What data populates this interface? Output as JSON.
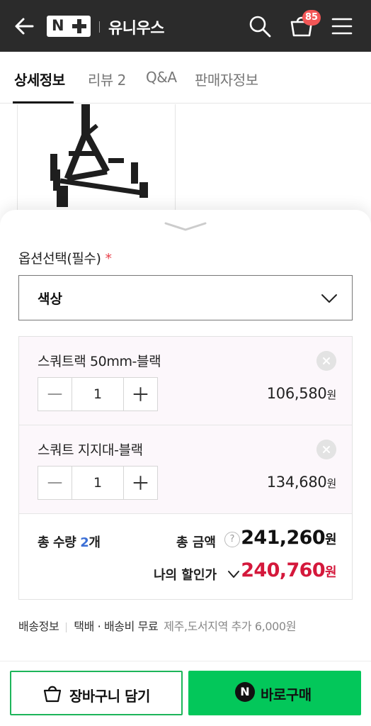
{
  "header": {
    "logo_text": "N",
    "store_name": "유니우스",
    "cart_count": "85"
  },
  "tabs": [
    {
      "label": "상세정보",
      "active": true
    },
    {
      "label": "리뷰 2"
    },
    {
      "label": "Q&A"
    },
    {
      "label": "판매자정보"
    }
  ],
  "options": {
    "label": "옵션선택(필수)",
    "required_mark": "*",
    "select_value": "색상"
  },
  "items": [
    {
      "name": "스쿼트랙 50mm-블랙",
      "qty": "1",
      "price": "106,580",
      "currency": "원"
    },
    {
      "name": "스쿼트 지지대-블랙",
      "qty": "1",
      "price": "134,680",
      "currency": "원"
    }
  ],
  "summary": {
    "qty_label": "총 수량",
    "qty_value": "2",
    "qty_unit": "개",
    "total_label": "총 금액",
    "help_glyph": "?",
    "total_value": "241,260",
    "currency": "원",
    "discount_label": "나의 할인가",
    "discount_value": "240,760"
  },
  "shipping": {
    "label": "배송정보",
    "method": "택배",
    "dot": "·",
    "fee": "배송비 무료",
    "extra": "제주,도서지역 추가 6,000원"
  },
  "buttons": {
    "cart": "장바구니 담기",
    "buy": "바로구매",
    "buy_icon_letter": "N"
  },
  "colors": {
    "header_bg": "#2b2b2b",
    "accent_green": "#03c75a",
    "discount_red": "#d4183b",
    "badge_red": "#f25656",
    "qty_blue": "#3b6fd6"
  }
}
